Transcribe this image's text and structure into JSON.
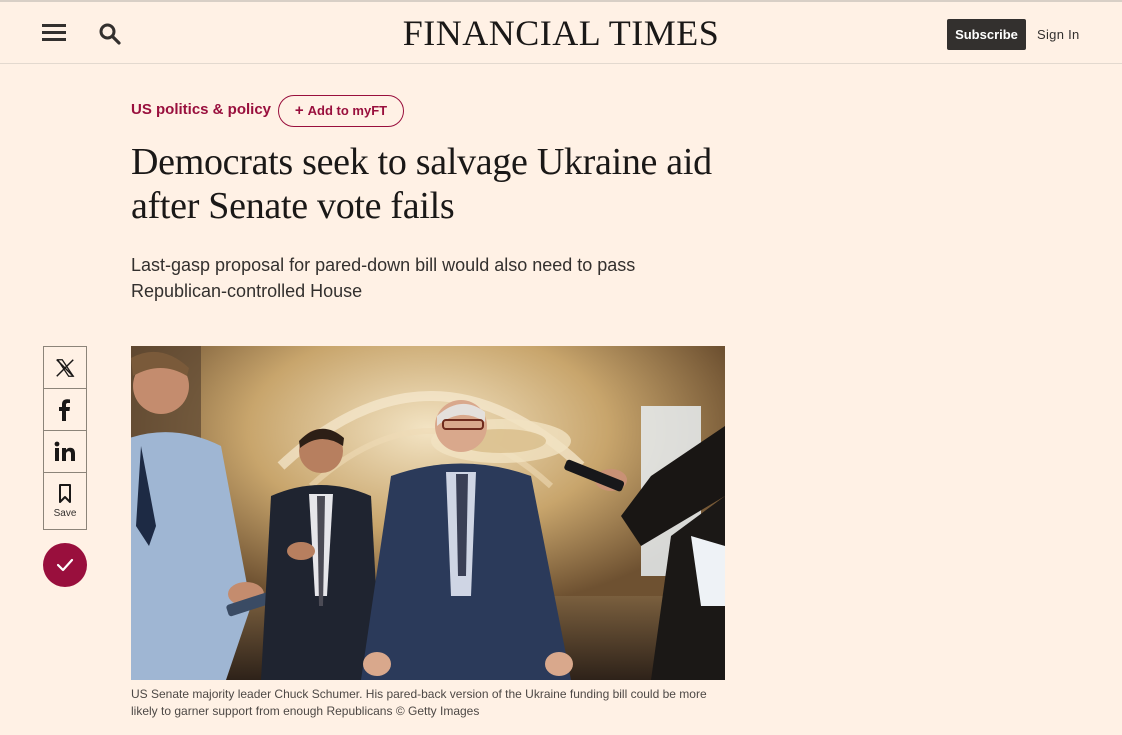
{
  "header": {
    "logo": "FINANCIAL TIMES",
    "subscribe_label": "Subscribe",
    "signin_label": "Sign In",
    "menu_icon": "hamburger-icon",
    "search_icon": "search-icon"
  },
  "article": {
    "topic": "US politics & policy",
    "add_myft_label": "Add to myFT",
    "headline": "Democrats seek to salvage Ukraine aid after Senate vote fails",
    "standfirst": "Last-gasp proposal for pared-down bill would also need to pass Republican-controlled House",
    "caption": "US Senate majority leader Chuck Schumer. His pared-back version of the Ukraine funding bill could be more likely to garner support from enough Republicans © Getty Images"
  },
  "share": {
    "items": [
      {
        "icon": "x-icon"
      },
      {
        "icon": "facebook-icon"
      },
      {
        "icon": "linkedin-icon"
      },
      {
        "icon": "bookmark-icon",
        "label": "Save"
      }
    ]
  },
  "colors": {
    "background": "#fff1e5",
    "accent": "#990f3d",
    "text": "#33302e",
    "button_dark": "#33302e"
  }
}
